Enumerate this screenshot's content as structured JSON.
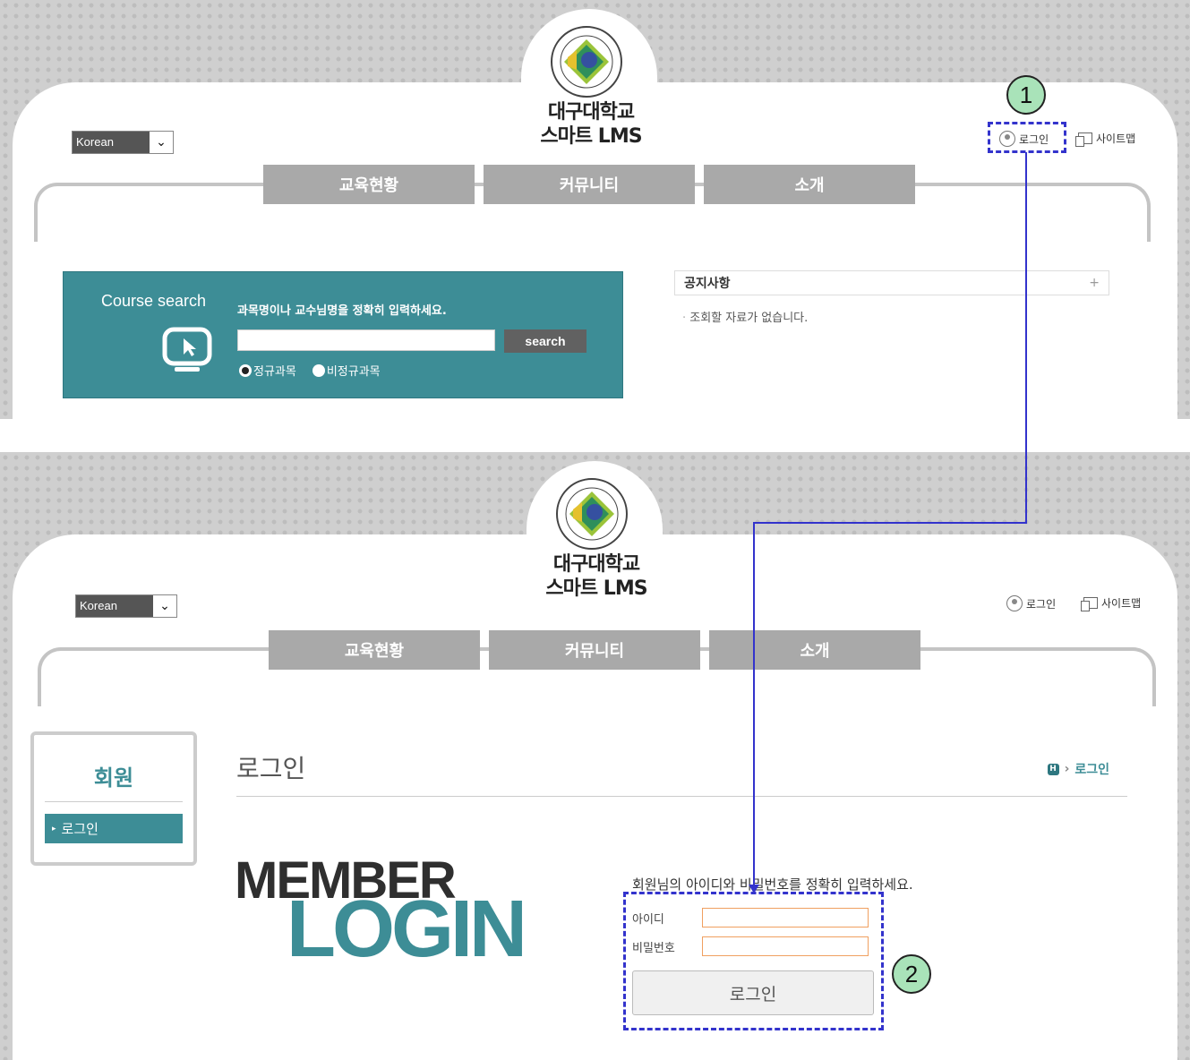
{
  "brand": {
    "line1": "대구대학교",
    "line2": "스마트 LMS"
  },
  "language": {
    "selected": "Korean"
  },
  "utility": {
    "login": "로그인",
    "sitemap": "사이트맵"
  },
  "nav": [
    "교육현황",
    "커뮤니티",
    "소개"
  ],
  "course_search": {
    "title": "Course search",
    "instruction": "과목명이나 교수님명을 정확히 입력하세요.",
    "input_value": "",
    "button": "search",
    "radio_options": [
      "정규과목",
      "비정규과목"
    ],
    "radio_selected": "정규과목"
  },
  "notice": {
    "title": "공지사항",
    "more": "+",
    "empty": "조회할 자료가 없습니다."
  },
  "sidebar": {
    "title": "회원",
    "items": [
      "로그인"
    ]
  },
  "page": {
    "title": "로그인",
    "breadcrumb": "로그인"
  },
  "member_login": {
    "line1": "MEMBER",
    "line2": "LOGIN"
  },
  "login_form": {
    "instruction": "회원님의 아이디와 비밀번호를 정확히 입력하세요.",
    "id_label": "아이디",
    "id_value": "",
    "pw_label": "비밀번호",
    "pw_value": "",
    "button": "로그인"
  },
  "annotations": [
    "1",
    "2"
  ],
  "colors": {
    "teal": "#3d8d96",
    "nav_gray": "#a9a9a9",
    "annotation_blue": "#3333cc",
    "callout_green": "#a9e3b9"
  }
}
